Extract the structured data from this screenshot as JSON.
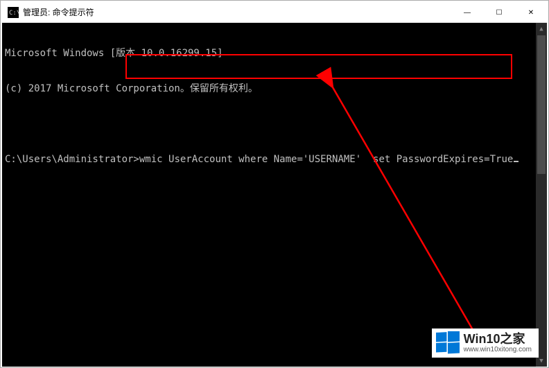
{
  "titlebar": {
    "icon_name": "cmd-icon",
    "title": "管理员: 命令提示符"
  },
  "window_controls": {
    "minimize": "—",
    "maximize": "☐",
    "close": "✕"
  },
  "terminal": {
    "line1": "Microsoft Windows [版本 10.0.16299.15]",
    "line2": "(c) 2017 Microsoft Corporation。保留所有权利。",
    "prompt": "C:\\Users\\Administrator>",
    "command": "wmic UserAccount where Name='USERNAME'  set PasswordExpires=True"
  },
  "watermark": {
    "title": "Win10之家",
    "url": "www.win10xitong.com"
  },
  "colors": {
    "highlight_border": "#ff0000",
    "arrow_color": "#ff0000",
    "terminal_bg": "#000000",
    "terminal_fg": "#c0c0c0",
    "logo_color": "#0078d7"
  }
}
